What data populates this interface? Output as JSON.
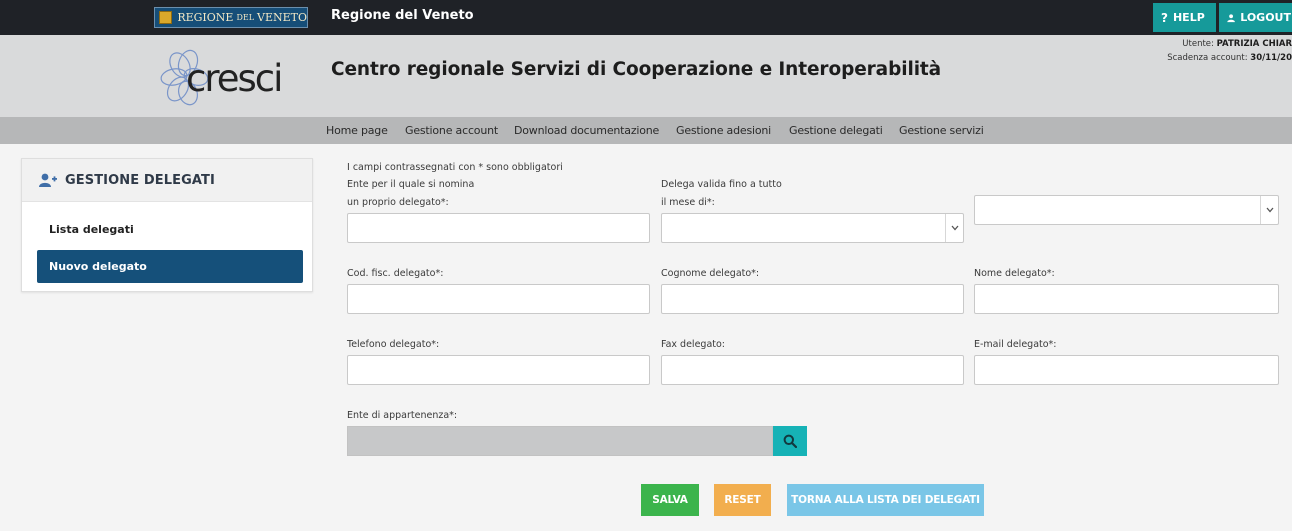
{
  "topbar": {
    "logo_text_1": "REGIONE",
    "logo_text_small": "DEL",
    "logo_text_2": "VENETO",
    "title": "Regione del Veneto",
    "help_label": "HELP",
    "logout_label": "LOGOUT"
  },
  "header": {
    "logo_word": "cresci",
    "site_title": "Centro regionale Servizi di Cooperazione e Interoperabilità",
    "user_label": "Utente:",
    "user_name": "PATRIZIA CHIAR",
    "expiry_label": "Scadenza account:",
    "expiry_value": "30/11/20"
  },
  "nav": {
    "items": [
      {
        "label": "Home page"
      },
      {
        "label": "Gestione account"
      },
      {
        "label": "Download documentazione"
      },
      {
        "label": "Gestione adesioni"
      },
      {
        "label": "Gestione delegati"
      },
      {
        "label": "Gestione servizi"
      }
    ]
  },
  "sidebar": {
    "title": "GESTIONE DELEGATI",
    "items": [
      {
        "label": "Lista delegati",
        "active": false
      },
      {
        "label": "Nuovo delegato",
        "active": true
      }
    ]
  },
  "form": {
    "required_note": "I campi contrassegnati con * sono obbligatori",
    "ente_label_1": "Ente per il quale si nomina",
    "ente_label_2": "un proprio delegato*:",
    "delega_label_1": "Delega valida fino a tutto",
    "delega_label_2": "il mese di*:",
    "cod_fisc_label": "Cod. fisc. delegato*:",
    "cognome_label": "Cognome delegato*:",
    "nome_label": "Nome delegato*:",
    "telefono_label": "Telefono delegato*:",
    "fax_label": "Fax delegato:",
    "email_label": "E-mail delegato*:",
    "ente_app_label": "Ente di appartenenza*:"
  },
  "buttons": {
    "save": "SALVA",
    "reset": "RESET",
    "back": "TORNA ALLA LISTA DEI DELEGATI"
  },
  "colors": {
    "topbar": "#1f2227",
    "teal": "#169a9a",
    "header": "#d9dadb",
    "nav": "#b6b7b8",
    "active_item": "#15507a",
    "save": "#3bb44c",
    "reset": "#f2ae4e",
    "back": "#7ac6e7",
    "search": "#16b2b6"
  },
  "icons": {
    "help": "question-icon",
    "logout": "user-icon",
    "sidebar": "add-user-icon",
    "search": "search-icon",
    "select": "chevron-down-icon"
  }
}
